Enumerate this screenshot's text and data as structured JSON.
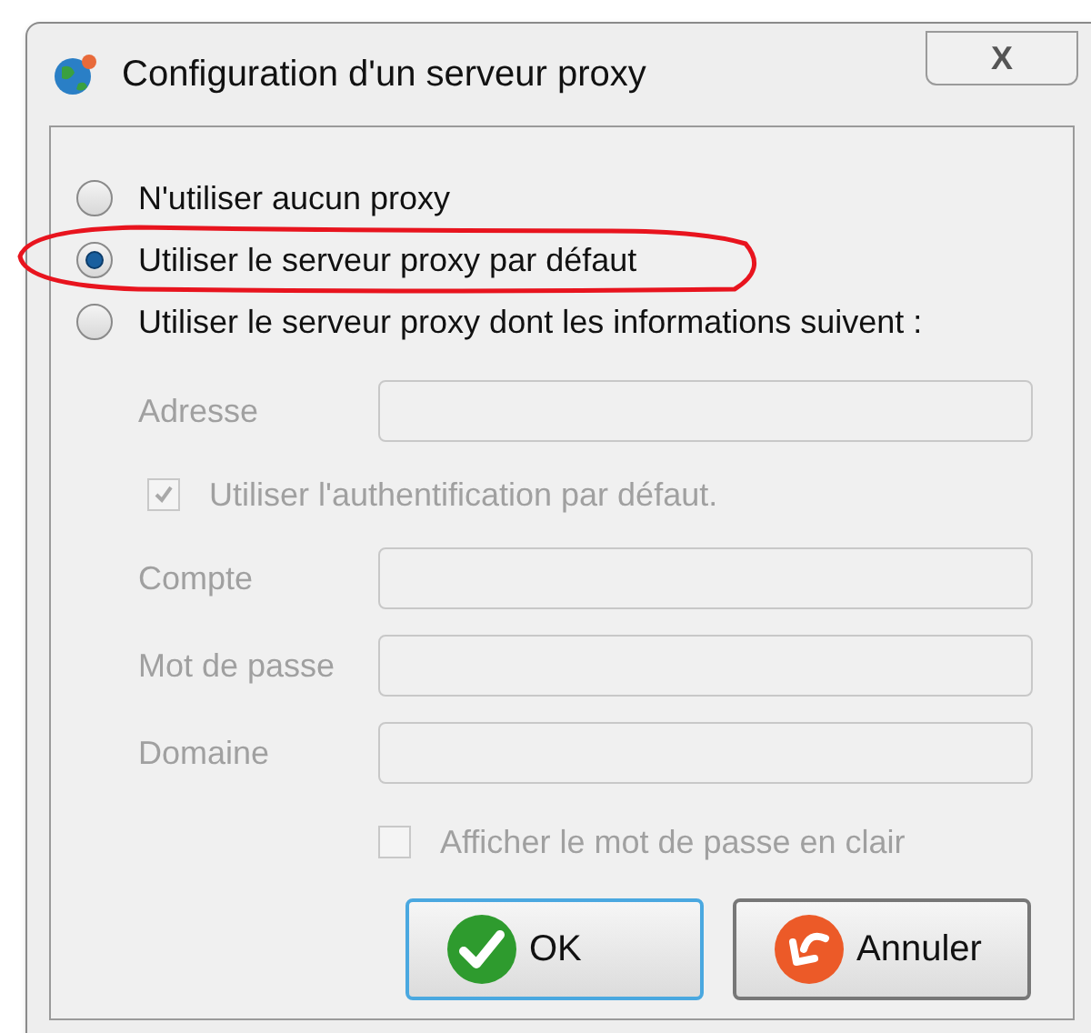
{
  "window": {
    "title": "Configuration d'un serveur proxy",
    "close_label": "X"
  },
  "options": [
    {
      "label": "N'utiliser aucun proxy",
      "selected": false
    },
    {
      "label": "Utiliser le serveur proxy par défaut",
      "selected": true
    },
    {
      "label": "Utiliser le serveur proxy dont les informations suivent :",
      "selected": false
    }
  ],
  "rows": [
    {
      "kind": "field",
      "label": "Adresse",
      "disabled": true
    },
    {
      "kind": "checkbox",
      "label": "Utiliser l'authentification par défaut.",
      "checked": true,
      "disabled": true
    },
    {
      "kind": "field",
      "label": "Compte",
      "disabled": true
    },
    {
      "kind": "field",
      "label": "Mot de passe",
      "disabled": true
    },
    {
      "kind": "field",
      "label": "Domaine",
      "disabled": true
    },
    {
      "kind": "checkbox-right",
      "label": "Afficher le mot de passe en clair",
      "checked": false,
      "disabled": true
    }
  ],
  "buttons": [
    {
      "kind": "ok",
      "label": "OK",
      "focused": true
    },
    {
      "kind": "cancel",
      "label": "Annuler",
      "focused": false
    }
  ]
}
